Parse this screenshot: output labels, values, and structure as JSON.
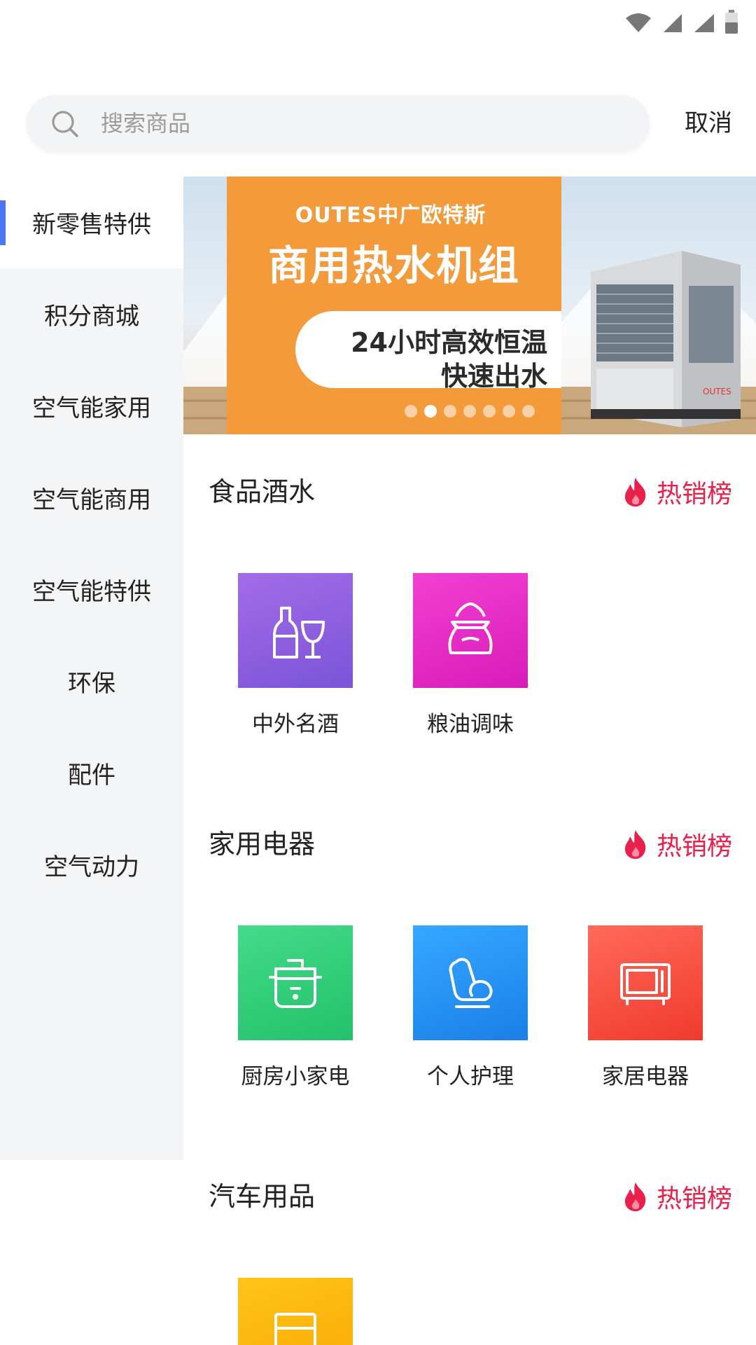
{
  "search": {
    "placeholder": "搜索商品",
    "cancel_label": "取消"
  },
  "sidebar": {
    "items": [
      {
        "label": "新零售特供",
        "active": true
      },
      {
        "label": "积分商城"
      },
      {
        "label": "空气能家用"
      },
      {
        "label": "空气能商用"
      },
      {
        "label": "空气能特供"
      },
      {
        "label": "环保"
      },
      {
        "label": "配件"
      },
      {
        "label": "空气动力"
      }
    ]
  },
  "banner": {
    "brand": "OUTES中广欧特斯",
    "headline": "商用热水机组",
    "line1": "24小时高效恒温",
    "line2": "快速出水",
    "dots_total": 7,
    "dot_active_index": 1
  },
  "sections": [
    {
      "title": "食品酒水",
      "hot_label": "热销榜",
      "categories": [
        {
          "label": "中外名酒",
          "icon": "wine-icon",
          "color": "#8b5de0"
        },
        {
          "label": "粮油调味",
          "icon": "grain-sack-icon",
          "color": "#e528c6"
        }
      ]
    },
    {
      "title": "家用电器",
      "hot_label": "热销榜",
      "categories": [
        {
          "label": "厨房小家电",
          "icon": "rice-cooker-icon",
          "color": "#2fd07a"
        },
        {
          "label": "个人护理",
          "icon": "massage-chair-icon",
          "color": "#1f8ff0"
        },
        {
          "label": "家居电器",
          "icon": "microwave-icon",
          "color": "#f5453a"
        }
      ]
    },
    {
      "title": "汽车用品",
      "hot_label": "热销榜",
      "categories": [
        {
          "label": "",
          "icon": "car-accessory-icon",
          "color": "#f9b50a"
        }
      ]
    }
  ],
  "colors": {
    "accent": "#4a78f5",
    "hot": "#e8204a",
    "banner_orange": "#f39a3a"
  }
}
